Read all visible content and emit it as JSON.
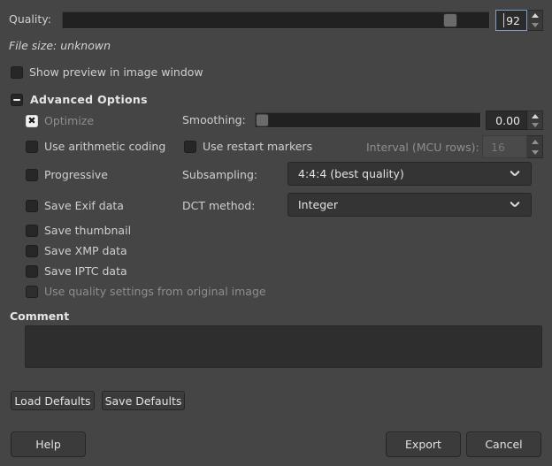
{
  "quality": {
    "label": "Quality:",
    "value": "92",
    "slider_percent": 92
  },
  "file_size": {
    "text": "File size: unknown"
  },
  "show_preview": {
    "label": "Show preview in image window",
    "checked": false
  },
  "advanced_options": {
    "label": "Advanced Options",
    "expanded": true,
    "expander_icon": "minus-icon"
  },
  "options": {
    "optimize": {
      "label": "Optimize",
      "checked": true,
      "disabled": true
    },
    "arithmetic": {
      "label": "Use arithmetic coding",
      "checked": false,
      "disabled": false
    },
    "progressive": {
      "label": "Progressive",
      "checked": false,
      "disabled": false
    },
    "save_exif": {
      "label": "Save Exif data",
      "checked": false,
      "disabled": false
    },
    "save_thumbnail": {
      "label": "Save thumbnail",
      "checked": false,
      "disabled": false
    },
    "save_xmp": {
      "label": "Save XMP data",
      "checked": false,
      "disabled": false
    },
    "save_iptc": {
      "label": "Save IPTC data",
      "checked": false,
      "disabled": false
    },
    "use_original_quality": {
      "label": "Use quality settings from original image",
      "checked": false,
      "disabled": true
    }
  },
  "smoothing": {
    "label": "Smoothing:",
    "value": "0.00",
    "slider_percent": 0
  },
  "restart_markers": {
    "label": "Use restart markers",
    "checked": false
  },
  "interval": {
    "label": "Interval (MCU rows):",
    "value": "16",
    "disabled": true
  },
  "subsampling": {
    "label": "Subsampling:",
    "value": "4:4:4 (best quality)",
    "chevron_icon": "chevron-down-icon"
  },
  "dct_method": {
    "label": "DCT method:",
    "value": "Integer",
    "chevron_icon": "chevron-down-icon"
  },
  "comment": {
    "heading": "Comment",
    "value": ""
  },
  "defaults": {
    "load_label": "Load Defaults",
    "save_label": "Save Defaults"
  },
  "actions": {
    "help_label": "Help",
    "export_label": "Export",
    "cancel_label": "Cancel"
  },
  "colors": {
    "background": "#454545",
    "control_dark": "#2b2b2b",
    "text": "#d6d6d6",
    "text_dim": "#8e8e8e",
    "focus_border": "#7d9ec0"
  }
}
